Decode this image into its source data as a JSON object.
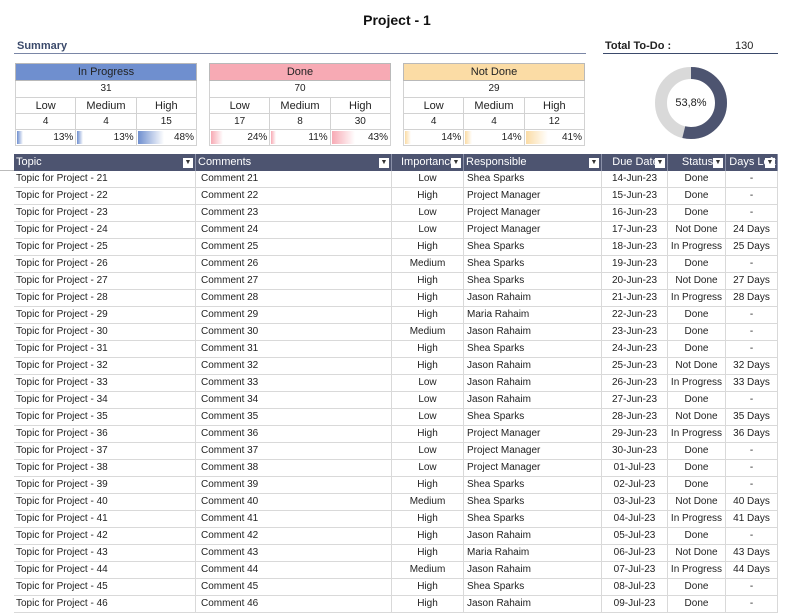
{
  "title": "Project - 1",
  "summary": {
    "label": "Summary"
  },
  "total": {
    "label": "Total To-Do :",
    "value": "130"
  },
  "boxes": [
    {
      "header": "In Progress",
      "header_color": "#6f8fcf",
      "bar_color": "#8ea7dd",
      "total": "31",
      "levels": [
        "Low",
        "Medium",
        "High"
      ],
      "counts": [
        "4",
        "4",
        "15"
      ],
      "pcts": [
        "13%",
        "13%",
        "48%"
      ],
      "pct_values": [
        13,
        13,
        48
      ]
    },
    {
      "header": "Done",
      "header_color": "#f7aab4",
      "bar_color": "#f7b5c0",
      "total": "70",
      "levels": [
        "Low",
        "Medium",
        "High"
      ],
      "counts": [
        "17",
        "8",
        "30"
      ],
      "pcts": [
        "24%",
        "11%",
        "43%"
      ],
      "pct_values": [
        24,
        11,
        43
      ]
    },
    {
      "header": "Not Done",
      "header_color": "#fbdca5",
      "bar_color": "#fbe0b0",
      "total": "29",
      "levels": [
        "Low",
        "Medium",
        "High"
      ],
      "counts": [
        "4",
        "4",
        "12"
      ],
      "pcts": [
        "14%",
        "14%",
        "41%"
      ],
      "pct_values": [
        14,
        14,
        41
      ]
    }
  ],
  "donut": {
    "label": "53,8%",
    "value": 53.8,
    "color": "#4d5470",
    "track": "#d9d9d9"
  },
  "table": {
    "headers": [
      "Topic",
      "Comments",
      "Importance",
      "Responsible",
      "Due Date",
      "Status",
      "Days Left"
    ],
    "dropdown_glyph": "▼",
    "rows": [
      [
        "Topic for Project - 21",
        "Comment 21",
        "Low",
        "Shea Sparks",
        "14-Jun-23",
        "Done",
        "-"
      ],
      [
        "Topic for Project - 22",
        "Comment 22",
        "High",
        "Project Manager",
        "15-Jun-23",
        "Done",
        "-"
      ],
      [
        "Topic for Project - 23",
        "Comment 23",
        "Low",
        "Project Manager",
        "16-Jun-23",
        "Done",
        "-"
      ],
      [
        "Topic for Project - 24",
        "Comment 24",
        "Low",
        "Project Manager",
        "17-Jun-23",
        "Not Done",
        "24 Days"
      ],
      [
        "Topic for Project - 25",
        "Comment 25",
        "High",
        "Shea Sparks",
        "18-Jun-23",
        "In Progress",
        "25 Days"
      ],
      [
        "Topic for Project - 26",
        "Comment 26",
        "Medium",
        "Shea Sparks",
        "19-Jun-23",
        "Done",
        "-"
      ],
      [
        "Topic for Project - 27",
        "Comment 27",
        "High",
        "Shea Sparks",
        "20-Jun-23",
        "Not Done",
        "27 Days"
      ],
      [
        "Topic for Project - 28",
        "Comment 28",
        "High",
        "Jason Rahaim",
        "21-Jun-23",
        "In Progress",
        "28 Days"
      ],
      [
        "Topic for Project - 29",
        "Comment 29",
        "High",
        "Maria Rahaim",
        "22-Jun-23",
        "Done",
        "-"
      ],
      [
        "Topic for Project - 30",
        "Comment 30",
        "Medium",
        "Jason Rahaim",
        "23-Jun-23",
        "Done",
        "-"
      ],
      [
        "Topic for Project - 31",
        "Comment 31",
        "High",
        "Shea Sparks",
        "24-Jun-23",
        "Done",
        "-"
      ],
      [
        "Topic for Project - 32",
        "Comment 32",
        "High",
        "Jason Rahaim",
        "25-Jun-23",
        "Not Done",
        "32 Days"
      ],
      [
        "Topic for Project - 33",
        "Comment 33",
        "Low",
        "Jason Rahaim",
        "26-Jun-23",
        "In Progress",
        "33 Days"
      ],
      [
        "Topic for Project - 34",
        "Comment 34",
        "Low",
        "Jason Rahaim",
        "27-Jun-23",
        "Done",
        "-"
      ],
      [
        "Topic for Project - 35",
        "Comment 35",
        "Low",
        "Shea Sparks",
        "28-Jun-23",
        "Not Done",
        "35 Days"
      ],
      [
        "Topic for Project - 36",
        "Comment 36",
        "High",
        "Project Manager",
        "29-Jun-23",
        "In Progress",
        "36 Days"
      ],
      [
        "Topic for Project - 37",
        "Comment 37",
        "Low",
        "Project Manager",
        "30-Jun-23",
        "Done",
        "-"
      ],
      [
        "Topic for Project - 38",
        "Comment 38",
        "Low",
        "Project Manager",
        "01-Jul-23",
        "Done",
        "-"
      ],
      [
        "Topic for Project - 39",
        "Comment 39",
        "High",
        "Shea Sparks",
        "02-Jul-23",
        "Done",
        "-"
      ],
      [
        "Topic for Project - 40",
        "Comment 40",
        "Medium",
        "Shea Sparks",
        "03-Jul-23",
        "Not Done",
        "40 Days"
      ],
      [
        "Topic for Project - 41",
        "Comment 41",
        "High",
        "Shea Sparks",
        "04-Jul-23",
        "In Progress",
        "41 Days"
      ],
      [
        "Topic for Project - 42",
        "Comment 42",
        "High",
        "Jason Rahaim",
        "05-Jul-23",
        "Done",
        "-"
      ],
      [
        "Topic for Project - 43",
        "Comment 43",
        "High",
        "Maria Rahaim",
        "06-Jul-23",
        "Not Done",
        "43 Days"
      ],
      [
        "Topic for Project - 44",
        "Comment 44",
        "Medium",
        "Jason Rahaim",
        "07-Jul-23",
        "In Progress",
        "44 Days"
      ],
      [
        "Topic for Project - 45",
        "Comment 45",
        "High",
        "Shea Sparks",
        "08-Jul-23",
        "Done",
        "-"
      ],
      [
        "Topic for Project - 46",
        "Comment 46",
        "High",
        "Jason Rahaim",
        "09-Jul-23",
        "Done",
        "-"
      ]
    ]
  }
}
